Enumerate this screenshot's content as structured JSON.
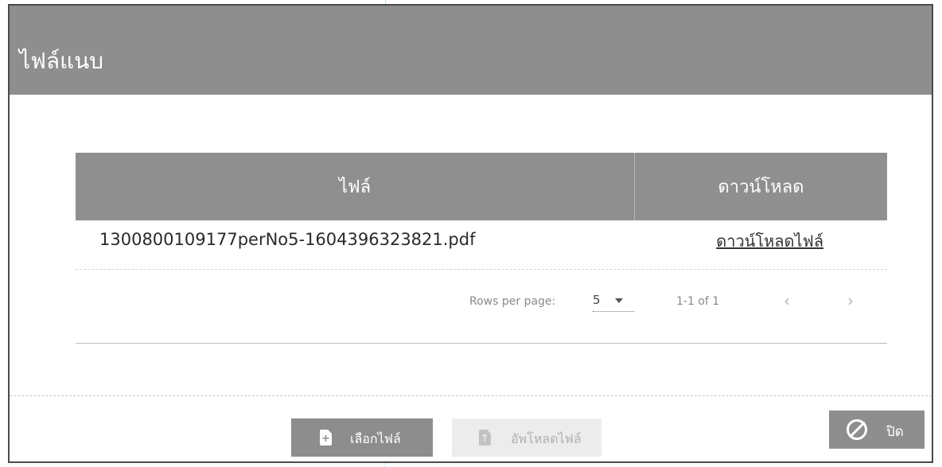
{
  "dialog": {
    "title": "ไฟล์แนบ"
  },
  "table": {
    "headers": {
      "file": "ไฟล์",
      "download": "ดาวน์โหลด"
    },
    "rows": [
      {
        "filename": "1300800109177perNo5-1604396323821.pdf",
        "download_link": "ดาวน์โหลดไฟล์"
      }
    ]
  },
  "pagination": {
    "rows_per_page_label": "Rows per page:",
    "rows_per_page_value": "5",
    "range": "1-1 of 1",
    "prev": "‹",
    "next": "›"
  },
  "footer": {
    "choose_file_label": "เลือกไฟล์",
    "upload_file_label": "อัพโหลดไฟล์",
    "close_label": "ปิด"
  }
}
